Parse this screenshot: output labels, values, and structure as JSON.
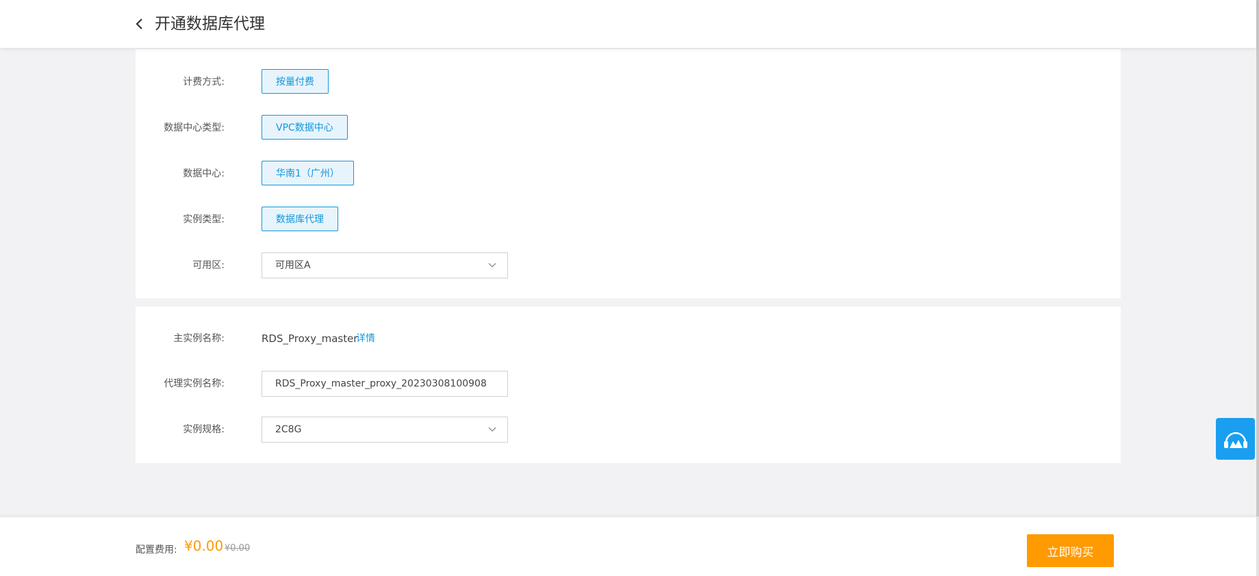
{
  "header": {
    "title": "开通数据库代理",
    "back_icon": "chevron-left-icon"
  },
  "form": {
    "billing": {
      "label": "计费方式:",
      "value": "按量付费"
    },
    "dc_type": {
      "label": "数据中心类型:",
      "value": "VPC数据中心"
    },
    "dc": {
      "label": "数据中心:",
      "value": "华南1（广州）"
    },
    "instance_type": {
      "label": "实例类型:",
      "value": "数据库代理"
    },
    "zone": {
      "label": "可用区:",
      "value": "可用区A"
    }
  },
  "instance": {
    "master": {
      "label": "主实例名称:",
      "value": "RDS_Proxy_master",
      "link": "详情"
    },
    "proxy_name": {
      "label": "代理实例名称:",
      "value": "RDS_Proxy_master_proxy_20230308100908"
    },
    "spec": {
      "label": "实例规格:",
      "value": "2C8G"
    }
  },
  "footer": {
    "fee_label": "配置费用:",
    "fee_value": "¥0.00",
    "fee_original": "¥0.00",
    "buy_label": "立即购买"
  },
  "colors": {
    "accent": "#1296db",
    "buy": "#ff9a00",
    "service_button": "#1a9ff0"
  },
  "floating": {
    "service_icon": "customer-service-icon"
  }
}
